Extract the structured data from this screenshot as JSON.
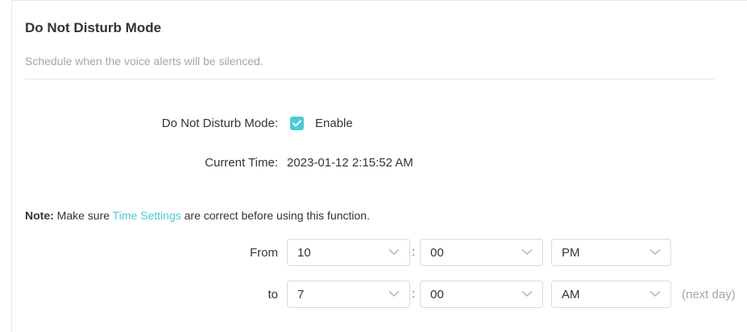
{
  "section": {
    "title": "Do Not Disturb Mode",
    "subtitle": "Schedule when the voice alerts will be silenced."
  },
  "dnd_mode": {
    "label": "Do Not Disturb Mode:",
    "checked": true,
    "enable_label": "Enable"
  },
  "current_time": {
    "label": "Current Time:",
    "value": "2023-01-12 2:15:52 AM"
  },
  "note": {
    "prefix": "Note:",
    "text_before": " Make sure ",
    "link": "Time Settings",
    "text_after": " are correct before using this function."
  },
  "schedule": {
    "from": {
      "label": "From",
      "hour": "10",
      "minute": "00",
      "period": "PM"
    },
    "to": {
      "label": "to",
      "hour": "7",
      "minute": "00",
      "period": "AM",
      "suffix": "(next day)"
    },
    "separator": ":"
  },
  "colors": {
    "accent": "#4acbd6",
    "muted": "#a6a6a6",
    "text": "#333333",
    "border": "#d9d9d9"
  },
  "icons": {
    "checkbox": "check-icon",
    "dropdown": "chevron-down-icon"
  }
}
